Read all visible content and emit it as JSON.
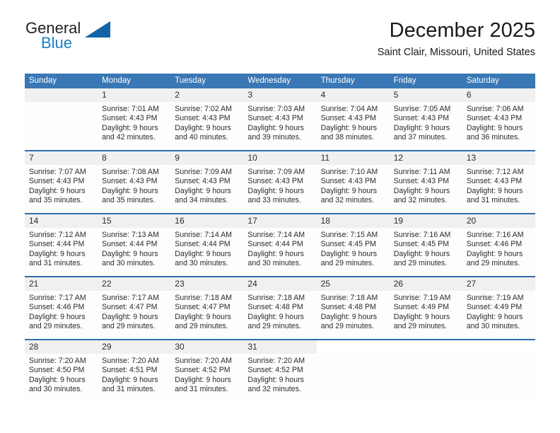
{
  "brand": {
    "name_top": "General",
    "name_bottom": "Blue",
    "triangle_color": "#1464a5",
    "blue_color": "#1c7fc4"
  },
  "header": {
    "title": "December 2025",
    "subtitle": "Saint Clair, Missouri, United States"
  },
  "theme": {
    "header_bar_color": "#3a77b5",
    "week_rule_color": "#2f6fae",
    "daynum_band_color": "#f0f0f0",
    "text_color": "#2b2b2b"
  },
  "calendar": {
    "day_headers": [
      "Sunday",
      "Monday",
      "Tuesday",
      "Wednesday",
      "Thursday",
      "Friday",
      "Saturday"
    ],
    "weeks": [
      {
        "days": [
          {
            "num": "",
            "lines": []
          },
          {
            "num": "1",
            "lines": [
              "Sunrise: 7:01 AM",
              "Sunset: 4:43 PM",
              "Daylight: 9 hours",
              "and 42 minutes."
            ]
          },
          {
            "num": "2",
            "lines": [
              "Sunrise: 7:02 AM",
              "Sunset: 4:43 PM",
              "Daylight: 9 hours",
              "and 40 minutes."
            ]
          },
          {
            "num": "3",
            "lines": [
              "Sunrise: 7:03 AM",
              "Sunset: 4:43 PM",
              "Daylight: 9 hours",
              "and 39 minutes."
            ]
          },
          {
            "num": "4",
            "lines": [
              "Sunrise: 7:04 AM",
              "Sunset: 4:43 PM",
              "Daylight: 9 hours",
              "and 38 minutes."
            ]
          },
          {
            "num": "5",
            "lines": [
              "Sunrise: 7:05 AM",
              "Sunset: 4:43 PM",
              "Daylight: 9 hours",
              "and 37 minutes."
            ]
          },
          {
            "num": "6",
            "lines": [
              "Sunrise: 7:06 AM",
              "Sunset: 4:43 PM",
              "Daylight: 9 hours",
              "and 36 minutes."
            ]
          }
        ]
      },
      {
        "days": [
          {
            "num": "7",
            "lines": [
              "Sunrise: 7:07 AM",
              "Sunset: 4:43 PM",
              "Daylight: 9 hours",
              "and 35 minutes."
            ]
          },
          {
            "num": "8",
            "lines": [
              "Sunrise: 7:08 AM",
              "Sunset: 4:43 PM",
              "Daylight: 9 hours",
              "and 35 minutes."
            ]
          },
          {
            "num": "9",
            "lines": [
              "Sunrise: 7:09 AM",
              "Sunset: 4:43 PM",
              "Daylight: 9 hours",
              "and 34 minutes."
            ]
          },
          {
            "num": "10",
            "lines": [
              "Sunrise: 7:09 AM",
              "Sunset: 4:43 PM",
              "Daylight: 9 hours",
              "and 33 minutes."
            ]
          },
          {
            "num": "11",
            "lines": [
              "Sunrise: 7:10 AM",
              "Sunset: 4:43 PM",
              "Daylight: 9 hours",
              "and 32 minutes."
            ]
          },
          {
            "num": "12",
            "lines": [
              "Sunrise: 7:11 AM",
              "Sunset: 4:43 PM",
              "Daylight: 9 hours",
              "and 32 minutes."
            ]
          },
          {
            "num": "13",
            "lines": [
              "Sunrise: 7:12 AM",
              "Sunset: 4:43 PM",
              "Daylight: 9 hours",
              "and 31 minutes."
            ]
          }
        ]
      },
      {
        "days": [
          {
            "num": "14",
            "lines": [
              "Sunrise: 7:12 AM",
              "Sunset: 4:44 PM",
              "Daylight: 9 hours",
              "and 31 minutes."
            ]
          },
          {
            "num": "15",
            "lines": [
              "Sunrise: 7:13 AM",
              "Sunset: 4:44 PM",
              "Daylight: 9 hours",
              "and 30 minutes."
            ]
          },
          {
            "num": "16",
            "lines": [
              "Sunrise: 7:14 AM",
              "Sunset: 4:44 PM",
              "Daylight: 9 hours",
              "and 30 minutes."
            ]
          },
          {
            "num": "17",
            "lines": [
              "Sunrise: 7:14 AM",
              "Sunset: 4:44 PM",
              "Daylight: 9 hours",
              "and 30 minutes."
            ]
          },
          {
            "num": "18",
            "lines": [
              "Sunrise: 7:15 AM",
              "Sunset: 4:45 PM",
              "Daylight: 9 hours",
              "and 29 minutes."
            ]
          },
          {
            "num": "19",
            "lines": [
              "Sunrise: 7:16 AM",
              "Sunset: 4:45 PM",
              "Daylight: 9 hours",
              "and 29 minutes."
            ]
          },
          {
            "num": "20",
            "lines": [
              "Sunrise: 7:16 AM",
              "Sunset: 4:46 PM",
              "Daylight: 9 hours",
              "and 29 minutes."
            ]
          }
        ]
      },
      {
        "days": [
          {
            "num": "21",
            "lines": [
              "Sunrise: 7:17 AM",
              "Sunset: 4:46 PM",
              "Daylight: 9 hours",
              "and 29 minutes."
            ]
          },
          {
            "num": "22",
            "lines": [
              "Sunrise: 7:17 AM",
              "Sunset: 4:47 PM",
              "Daylight: 9 hours",
              "and 29 minutes."
            ]
          },
          {
            "num": "23",
            "lines": [
              "Sunrise: 7:18 AM",
              "Sunset: 4:47 PM",
              "Daylight: 9 hours",
              "and 29 minutes."
            ]
          },
          {
            "num": "24",
            "lines": [
              "Sunrise: 7:18 AM",
              "Sunset: 4:48 PM",
              "Daylight: 9 hours",
              "and 29 minutes."
            ]
          },
          {
            "num": "25",
            "lines": [
              "Sunrise: 7:18 AM",
              "Sunset: 4:48 PM",
              "Daylight: 9 hours",
              "and 29 minutes."
            ]
          },
          {
            "num": "26",
            "lines": [
              "Sunrise: 7:19 AM",
              "Sunset: 4:49 PM",
              "Daylight: 9 hours",
              "and 29 minutes."
            ]
          },
          {
            "num": "27",
            "lines": [
              "Sunrise: 7:19 AM",
              "Sunset: 4:49 PM",
              "Daylight: 9 hours",
              "and 30 minutes."
            ]
          }
        ]
      },
      {
        "days": [
          {
            "num": "28",
            "lines": [
              "Sunrise: 7:20 AM",
              "Sunset: 4:50 PM",
              "Daylight: 9 hours",
              "and 30 minutes."
            ]
          },
          {
            "num": "29",
            "lines": [
              "Sunrise: 7:20 AM",
              "Sunset: 4:51 PM",
              "Daylight: 9 hours",
              "and 31 minutes."
            ]
          },
          {
            "num": "30",
            "lines": [
              "Sunrise: 7:20 AM",
              "Sunset: 4:52 PM",
              "Daylight: 9 hours",
              "and 31 minutes."
            ]
          },
          {
            "num": "31",
            "lines": [
              "Sunrise: 7:20 AM",
              "Sunset: 4:52 PM",
              "Daylight: 9 hours",
              "and 32 minutes."
            ]
          },
          {
            "num": "",
            "lines": []
          },
          {
            "num": "",
            "lines": []
          },
          {
            "num": "",
            "lines": []
          }
        ]
      }
    ]
  }
}
